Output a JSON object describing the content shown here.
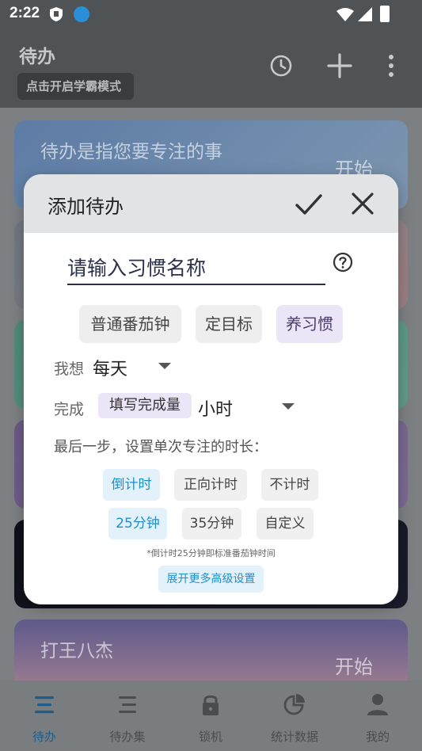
{
  "status_bar": {
    "time": "2:22"
  },
  "app_bar": {
    "title": "待办",
    "mode_chip": "点击开启学霸模式"
  },
  "cards": [
    {
      "title": "待办是指您要专注的事",
      "start": "开始"
    },
    {
      "title": "",
      "start": ""
    },
    {
      "title": "",
      "start": ""
    },
    {
      "title": "",
      "start": ""
    },
    {
      "title": "",
      "start": ""
    },
    {
      "title": "打王八杰",
      "start": "开始"
    }
  ],
  "dialog": {
    "title": "添加待办",
    "input_placeholder": "请输入习惯名称",
    "mode_buttons": [
      "普通番茄钟",
      "定目标",
      "养习惯"
    ],
    "selected_mode": "养习惯",
    "want_label": "我想",
    "frequency_value": "每天",
    "complete_label": "完成",
    "fill_amount_chip": "填写完成量",
    "unit_value": "小时",
    "last_step_text": "最后一步，设置单次专注的时长：",
    "timer_options": [
      "倒计时",
      "正向计时",
      "不计时"
    ],
    "duration_options": [
      "25分钟",
      "35分钟",
      "自定义"
    ],
    "note": "*倒计时25分钟即标准番茄钟时间",
    "advanced_button": "展开更多高级设置"
  },
  "bottom_nav": [
    {
      "label": "待办",
      "icon": "list-icon",
      "active": true
    },
    {
      "label": "待办集",
      "icon": "checklist-icon",
      "active": false
    },
    {
      "label": "锁机",
      "icon": "lock-icon",
      "active": false
    },
    {
      "label": "统计数据",
      "icon": "pie-chart-icon",
      "active": false
    },
    {
      "label": "我的",
      "icon": "person-icon",
      "active": false
    }
  ],
  "colors": {
    "accent": "#1f8fd0",
    "selected_chip": "#ece4f7",
    "nav_active": "#1e5c8a"
  }
}
